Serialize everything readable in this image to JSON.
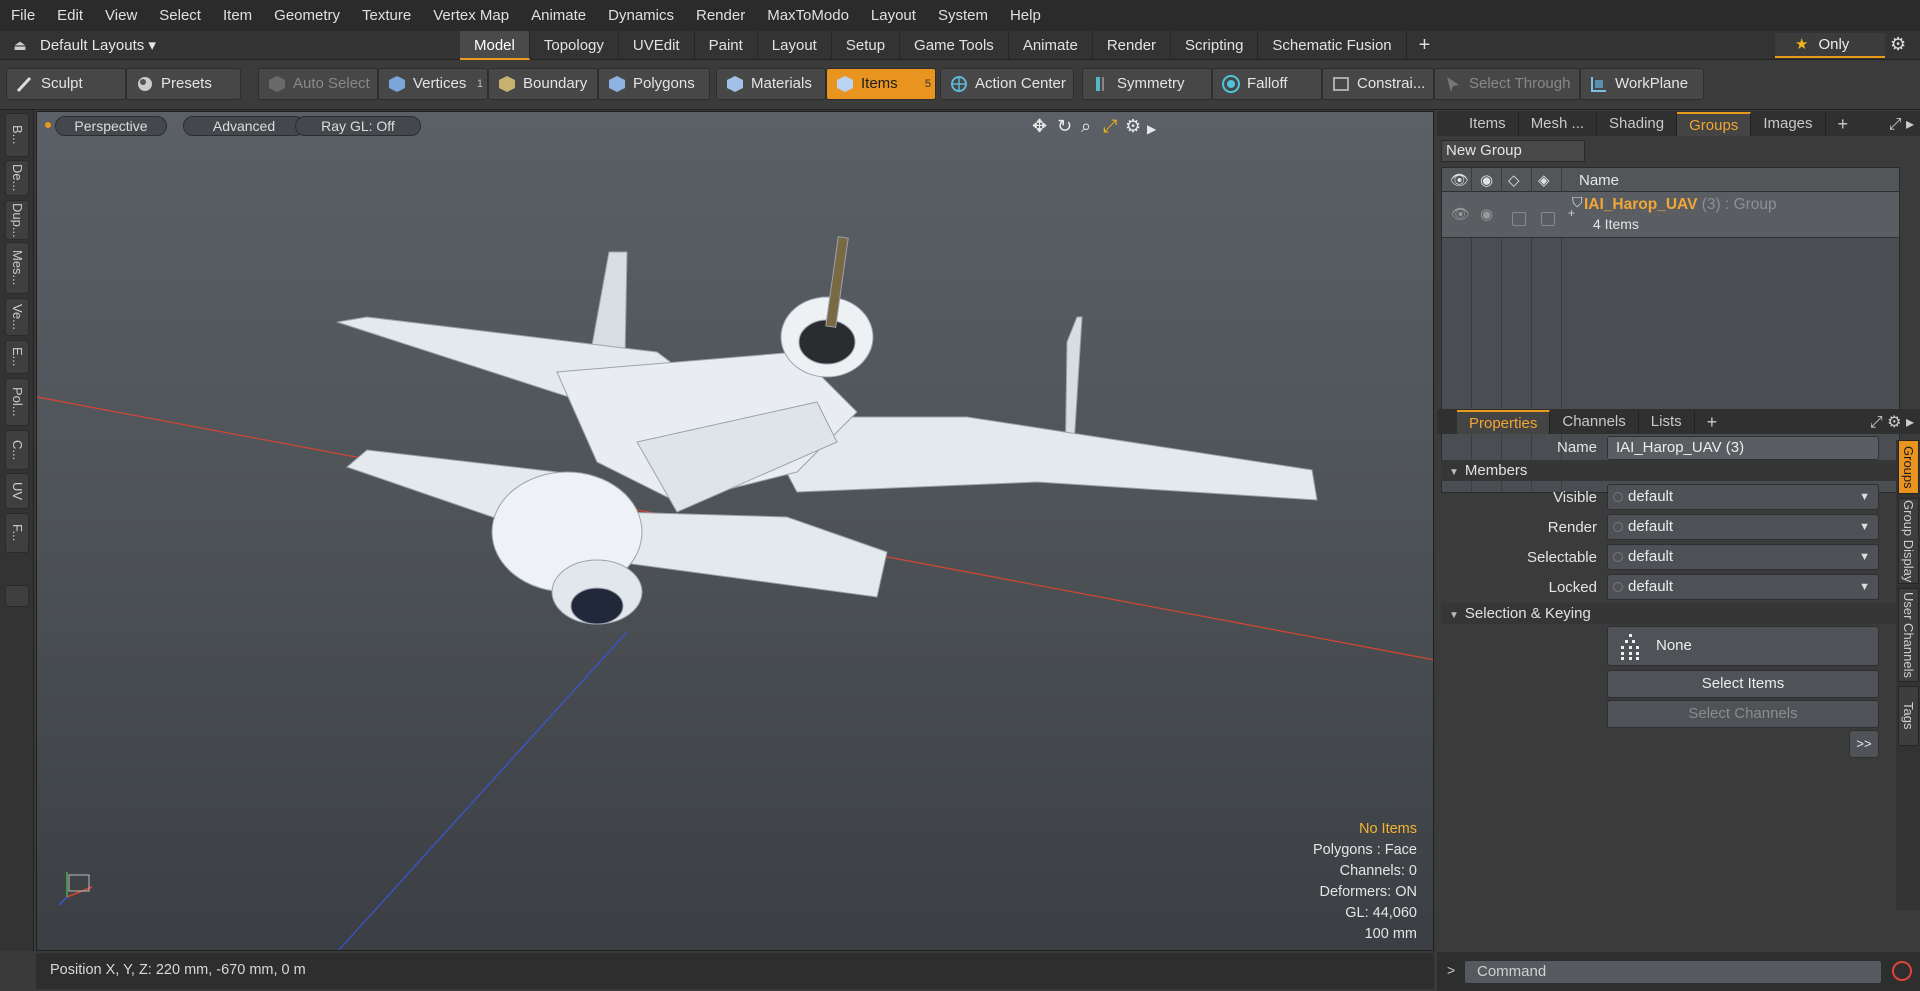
{
  "menu": [
    "File",
    "Edit",
    "View",
    "Select",
    "Item",
    "Geometry",
    "Texture",
    "Vertex Map",
    "Animate",
    "Dynamics",
    "Render",
    "MaxToModo",
    "Layout",
    "System",
    "Help"
  ],
  "layout": {
    "preset": "Default Layouts ▾",
    "tabs": [
      "Model",
      "Topology",
      "UVEdit",
      "Paint",
      "Layout",
      "Setup",
      "Game Tools",
      "Animate",
      "Render",
      "Scripting",
      "Schematic Fusion"
    ],
    "active_tab": "Model",
    "only_label": "Only"
  },
  "toolbar": {
    "sculpt": "Sculpt",
    "presets": "Presets",
    "auto_select": "Auto Select",
    "vertices": "Vertices",
    "vertices_count": "1",
    "boundary": "Boundary",
    "polygons": "Polygons",
    "materials": "Materials",
    "items": "Items",
    "items_count": "5",
    "action_center": "Action Center",
    "symmetry": "Symmetry",
    "falloff": "Falloff",
    "constraints": "Constrai...",
    "select_through": "Select Through",
    "workplane": "WorkPlane"
  },
  "left_tabs": [
    "B...",
    "De...",
    "Dup...",
    "Mes...",
    "Ve...",
    "E...",
    "Pol...",
    "C...",
    "UV",
    "F..."
  ],
  "viewport": {
    "view": "Perspective",
    "shading": "Advanced",
    "raygl": "Ray GL: Off",
    "info": {
      "items": "No Items",
      "polygons": "Polygons : Face",
      "channels": "Channels: 0",
      "deformers": "Deformers: ON",
      "gl": "GL: 44,060",
      "scale": "100 mm"
    }
  },
  "status": "Position X, Y, Z:   220 mm, -670 mm, 0 m",
  "groups_panel": {
    "tabs": [
      "Items",
      "Mesh ...",
      "Shading",
      "Groups",
      "Images"
    ],
    "active_tab": "Groups",
    "new_group": "New Group",
    "name_header": "Name",
    "group": {
      "name": "IAI_Harop_UAV",
      "suffix": " (3) : Group",
      "sub": "4 Items"
    }
  },
  "properties": {
    "tabs": [
      "Properties",
      "Channels",
      "Lists"
    ],
    "active_tab": "Properties",
    "name_label": "Name",
    "name_value": "IAI_Harop_UAV (3)",
    "members_section": "Members",
    "visible_label": "Visible",
    "visible_value": "default",
    "render_label": "Render",
    "render_value": "default",
    "selectable_label": "Selectable",
    "selectable_value": "default",
    "locked_label": "Locked",
    "locked_value": "default",
    "keying_section": "Selection & Keying",
    "none_label": "None",
    "select_items": "Select Items",
    "select_channels": "Select Channels",
    "more": ">>",
    "vtabs": [
      "Groups",
      "Group Display",
      "User Channels",
      "Tags"
    ]
  },
  "command": {
    "prompt": ">",
    "placeholder": "Command"
  },
  "colors": {
    "accent": "#e8941e",
    "group_name": "#f2a633",
    "x_axis": "#d9452e",
    "z_axis": "#3a55d8"
  }
}
